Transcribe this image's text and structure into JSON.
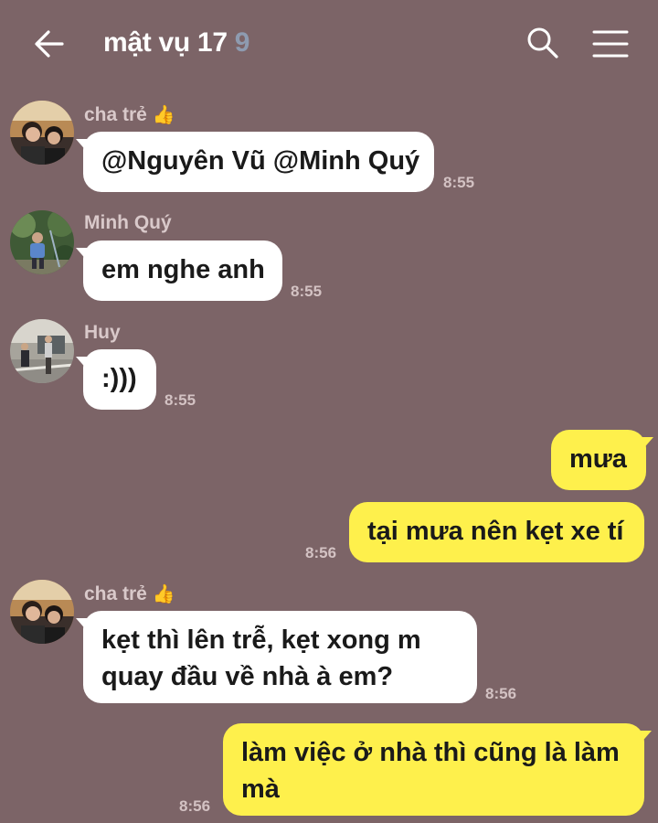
{
  "header": {
    "title": "mật vụ 17",
    "member_count": "9"
  },
  "messages": [
    {
      "sender": "cha trẻ",
      "text": "@Nguyên Vũ @Minh Quý",
      "time": "8:55"
    },
    {
      "sender": "Minh Quý",
      "text": "em nghe anh",
      "time": "8:55"
    },
    {
      "sender": "Huy",
      "text": ":)))",
      "time": "8:55"
    },
    {
      "text": "mưa"
    },
    {
      "text": "tại mưa nên kẹt xe tí",
      "time": "8:56"
    },
    {
      "sender": "cha trẻ",
      "text_line1": "kẹt thì lên trễ, kẹt xong m",
      "text_line2": "quay đầu về nhà à em?",
      "time": "8:56"
    },
    {
      "text_line1": "làm việc ở nhà thì cũng là làm",
      "text_line2": "mà",
      "time": "8:56"
    }
  ],
  "icons": {
    "back": "arrow-left",
    "search": "magnifier",
    "menu": "hamburger",
    "reaction": "thumbs-up"
  },
  "colors": {
    "background": "#7c6467",
    "incoming_bubble": "#ffffff",
    "outgoing_bubble": "#fef04c"
  }
}
